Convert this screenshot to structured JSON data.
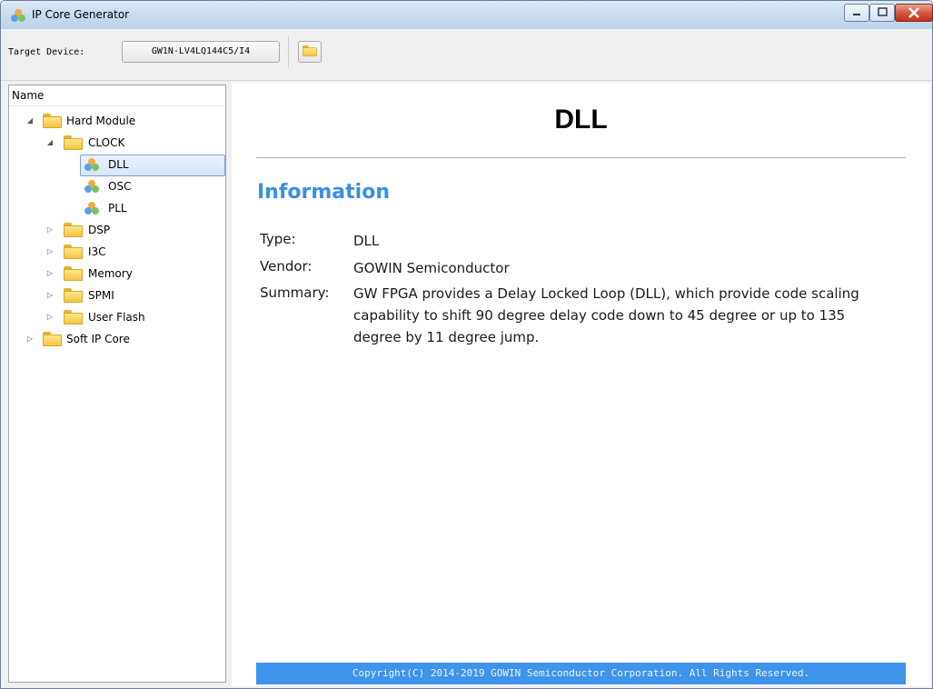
{
  "window": {
    "title": "IP Core Generator"
  },
  "toolbar": {
    "target_label": "Target Device:",
    "target_value": "GW1N-LV4LQ144C5/I4"
  },
  "tree": {
    "header": "Name",
    "nodes": {
      "hard_module": "Hard Module",
      "clock": "CLOCK",
      "dll": "DLL",
      "osc": "OSC",
      "pll": "PLL",
      "dsp": "DSP",
      "i3c": "I3C",
      "memory": "Memory",
      "spmi": "SPMI",
      "user_flash": "User Flash",
      "soft_ip_core": "Soft IP Core"
    },
    "selected": "DLL"
  },
  "content": {
    "title": "DLL",
    "section": "Information",
    "type_label": "Type:",
    "type_value": "DLL",
    "vendor_label": "Vendor:",
    "vendor_value": "GOWIN Semiconductor",
    "summary_label": "Summary:",
    "summary_value": "GW FPGA provides a Delay Locked Loop (DLL), which provide code scaling capability to shift 90 degree delay code down to 45 degree or up to 135 degree by 11 degree jump.",
    "footer": "Copyright(C) 2014-2019 GOWIN Semiconductor Corporation. All Rights Reserved."
  },
  "colors": {
    "accent": "#3a8ee6",
    "footer_bg": "#3e94eb",
    "folder": "#f4c541"
  }
}
